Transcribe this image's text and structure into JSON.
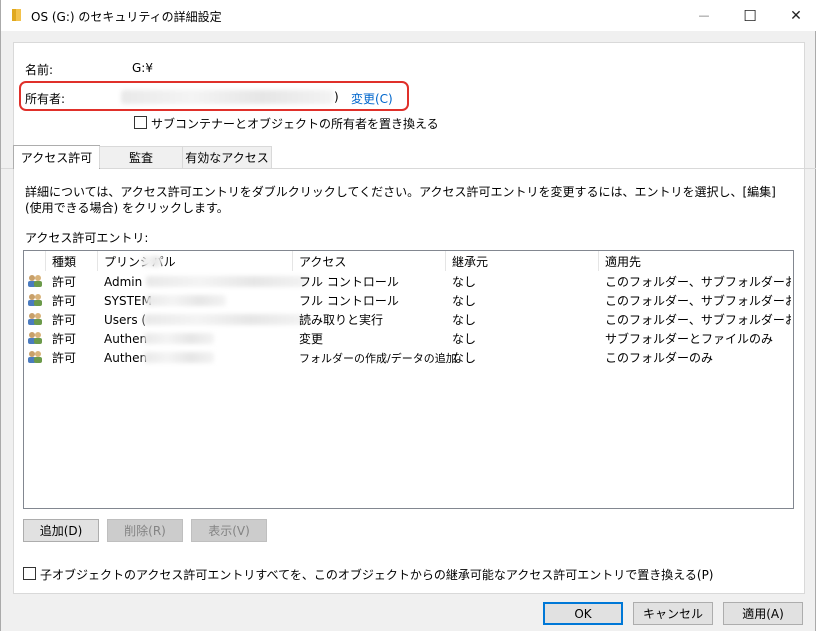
{
  "window": {
    "title": "OS (G:) のセキュリティの詳細設定",
    "minimize_glyph": "—",
    "maximize_glyph": "☐",
    "close_glyph": "✕"
  },
  "owner_section": {
    "name_label": "名前:",
    "name_value": "G:¥",
    "owner_label": "所有者:",
    "owner_paren": ")",
    "change_link": "変更(C)",
    "replace_owner_checkbox": "サブコンテナーとオブジェクトの所有者を置き換える",
    "highlight_color": "#e0302a"
  },
  "tabs": [
    {
      "label": "アクセス許可",
      "active": true
    },
    {
      "label": "監査",
      "active": false
    },
    {
      "label": "有効なアクセス",
      "active": false
    }
  ],
  "description": "詳細については、アクセス許可エントリをダブルクリックしてください。アクセス許可エントリを変更するには、エントリを選択し、[編集] (使用できる場合) をクリックします。",
  "entries_label": "アクセス許可エントリ:",
  "table": {
    "columns": [
      "種類",
      "プリンシパル",
      "アクセス",
      "継承元",
      "適用先"
    ],
    "rows": [
      {
        "type": "許可",
        "principal": "Admin",
        "access": "フル コントロール",
        "inherited": "なし",
        "applies": "このフォルダー、サブフォルダーおよびファ..."
      },
      {
        "type": "許可",
        "principal": "SYSTEM",
        "access": "フル コントロール",
        "inherited": "なし",
        "applies": "このフォルダー、サブフォルダーおよびファ..."
      },
      {
        "type": "許可",
        "principal": "Users (",
        "access": "読み取りと実行",
        "inherited": "なし",
        "applies": "このフォルダー、サブフォルダーおよびファ..."
      },
      {
        "type": "許可",
        "principal": "Authen",
        "access": "変更",
        "inherited": "なし",
        "applies": "サブフォルダーとファイルのみ"
      },
      {
        "type": "許可",
        "principal": "Authen",
        "access": "フォルダーの作成/データの追加",
        "inherited": "なし",
        "applies": "このフォルダーのみ"
      }
    ]
  },
  "buttons": {
    "add": "追加(D)",
    "remove": "削除(R)",
    "view": "表示(V)",
    "ok": "OK",
    "cancel": "キャンセル",
    "apply": "適用(A)"
  },
  "replace_child_checkbox": "子オブジェクトのアクセス許可エントリすべてを、このオブジェクトからの継承可能なアクセス許可エントリで置き換える(P)"
}
